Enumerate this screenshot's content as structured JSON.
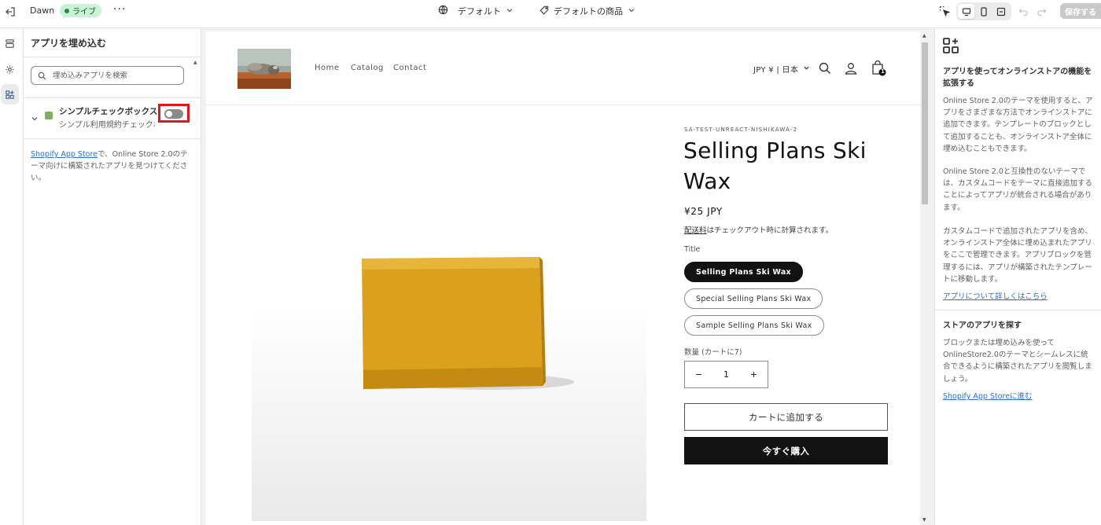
{
  "topbar": {
    "theme_name": "Dawn",
    "status_badge": "ライブ",
    "more_label": "···",
    "template_selector": "デフォルト",
    "product_selector": "デフォルトの商品",
    "save_label": "保存する",
    "icons": [
      "exit-icon",
      "globe-icon",
      "tag-icon",
      "inspector-icon",
      "desktop-icon",
      "mobile-icon",
      "fullscreen-icon",
      "undo-icon",
      "redo-icon"
    ]
  },
  "rail": {
    "items": [
      "sections-icon",
      "settings-icon",
      "apps-icon"
    ],
    "active": "apps-icon"
  },
  "left_panel": {
    "title": "アプリを埋め込む",
    "search_placeholder": "埋め込みアプリを検索",
    "app": {
      "name": "シンプルチェックボックス",
      "description": "シンプル利用規約チェックボックス",
      "enabled": false
    },
    "footer_link": "Shopify App Store",
    "footer_text": "で、Online Store 2.0のテーマ向けに構築されたアプリを見つけてください。"
  },
  "store": {
    "nav": [
      "Home",
      "Catalog",
      "Contact"
    ],
    "currency": "JPY ¥ | 日本",
    "cart_count": "1",
    "vendor": "SA-TEST-UNREACT-NISHIKAWA-2",
    "title": "Selling Plans Ski Wax",
    "price": "¥25 JPY",
    "shipping_link": "配送料",
    "shipping_text": "はチェックアウト時に計算されます。",
    "option_label": "Title",
    "options": [
      "Selling Plans Ski Wax",
      "Special Selling Plans Ski Wax",
      "Sample Selling Plans Ski Wax"
    ],
    "selected_option": "Selling Plans Ski Wax",
    "quantity_label": "数量 (カートに7)",
    "quantity": "1",
    "minus": "−",
    "plus": "+",
    "add_to_cart": "カートに追加する",
    "buy_now": "今すぐ購入"
  },
  "right_panel": {
    "heading1": "アプリを使ってオンラインストアの機能を拡張する",
    "para1": "Online Store 2.0のテーマを使用すると、アプリをさまざまな方法でオンラインストアに追加できます。テンプレートのブロックとして追加することも、オンラインストア全体に埋め込むこともできます。",
    "para2": "Online Store 2.0と互換性のないテーマでは、カスタムコードをテーマに直接追加することによってアプリが統合される場合があります。",
    "para3": "カスタムコードで追加されたアプリを含め、オンラインストア全体に埋め込まれたアプリをここで管理できます。アプリブロックを管理するには、アプリが構築されたテンプレートに移動します。",
    "link1": "アプリについて詳しくはこちら",
    "heading2": "ストアのアプリを探す",
    "para4": "ブロックまたは埋め込みを使ってOnlineStore2.0のテーマとシームレスに統合できるように構築されたアプリを閲覧しましょう。",
    "link2": "Shopify App Storeに進む"
  }
}
